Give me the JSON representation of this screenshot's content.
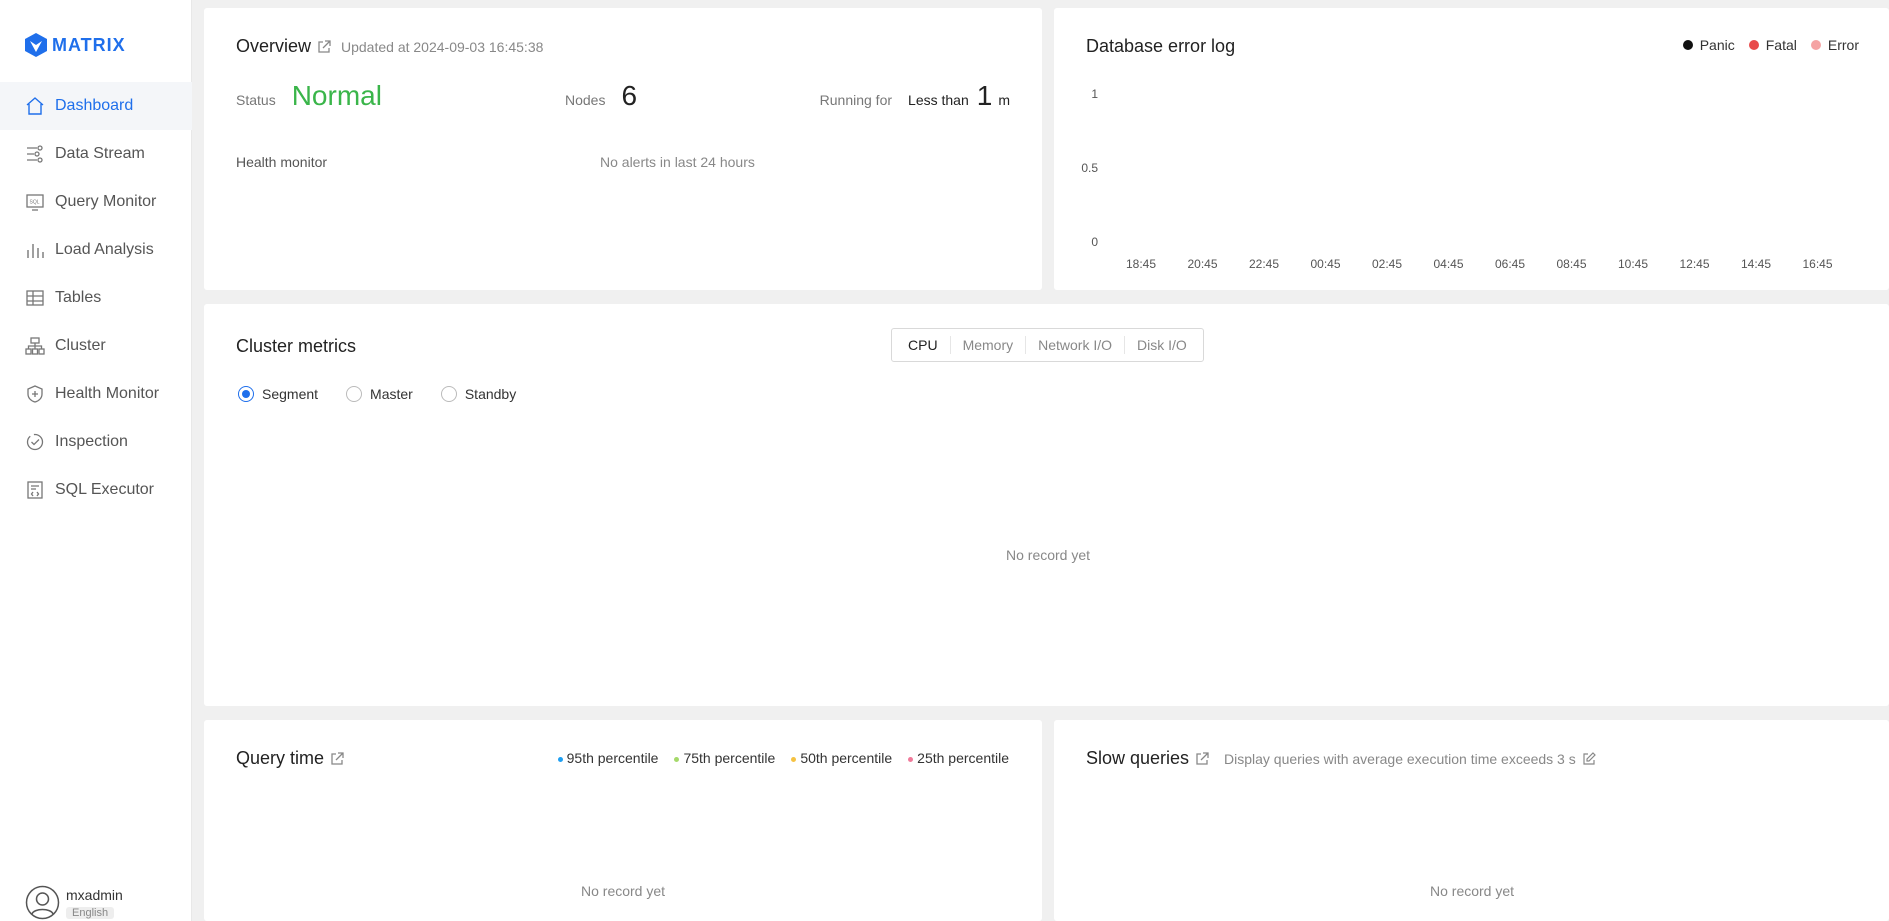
{
  "app": {
    "brand": "MATRIX"
  },
  "sidebar": {
    "items": [
      {
        "label": "Dashboard",
        "icon": "home-icon",
        "active": true
      },
      {
        "label": "Data Stream",
        "icon": "data-stream-icon"
      },
      {
        "label": "Query Monitor",
        "icon": "sql-monitor-icon"
      },
      {
        "label": "Load Analysis",
        "icon": "bar-analysis-icon"
      },
      {
        "label": "Tables",
        "icon": "table-icon"
      },
      {
        "label": "Cluster",
        "icon": "cluster-icon"
      },
      {
        "label": "Health Monitor",
        "icon": "shield-plus-icon"
      },
      {
        "label": "Inspection",
        "icon": "inspection-icon"
      },
      {
        "label": "SQL Executor",
        "icon": "code-file-icon"
      }
    ],
    "user": {
      "name": "mxadmin",
      "language": "English"
    }
  },
  "overview": {
    "title": "Overview",
    "updated": "Updated at 2024-09-03 16:45:38",
    "status_label": "Status",
    "status_value": "Normal",
    "nodes_label": "Nodes",
    "nodes_value": "6",
    "running_label": "Running for",
    "running_prefix": "Less than",
    "running_value": "1",
    "running_unit": "m",
    "health_label": "Health monitor",
    "health_value": "No alerts in last 24 hours"
  },
  "error_log": {
    "title": "Database error log",
    "legend": [
      {
        "name": "Panic",
        "color": "#111111"
      },
      {
        "name": "Fatal",
        "color": "#e84a4a"
      },
      {
        "name": "Error",
        "color": "#f5a3a3"
      }
    ]
  },
  "chart_data": {
    "type": "line",
    "title": "Database error log",
    "x": [
      "18:45",
      "20:45",
      "22:45",
      "00:45",
      "02:45",
      "04:45",
      "06:45",
      "08:45",
      "10:45",
      "12:45",
      "14:45",
      "16:45"
    ],
    "y_ticks": [
      "1",
      "0.5",
      "0"
    ],
    "ylim": [
      0,
      1
    ],
    "series": [
      {
        "name": "Panic",
        "values": []
      },
      {
        "name": "Fatal",
        "values": []
      },
      {
        "name": "Error",
        "values": []
      }
    ],
    "legend_position": "top-right",
    "grid": false
  },
  "cluster": {
    "title": "Cluster metrics",
    "tabs": [
      "CPU",
      "Memory",
      "Network I/O",
      "Disk I/O"
    ],
    "roles": [
      "Segment",
      "Master",
      "Standby"
    ],
    "selected_role": "Segment",
    "empty": "No record yet"
  },
  "query_time": {
    "title": "Query time",
    "legend": [
      {
        "name": "95th percentile",
        "color": "#1e9ff2"
      },
      {
        "name": "75th percentile",
        "color": "#a5d96a"
      },
      {
        "name": "50th percentile",
        "color": "#f5c242"
      },
      {
        "name": "25th percentile",
        "color": "#f07a9a"
      }
    ],
    "empty": "No record yet"
  },
  "slow_queries": {
    "title": "Slow queries",
    "description": "Display queries with average execution time exceeds 3 s",
    "empty": "No record yet"
  }
}
